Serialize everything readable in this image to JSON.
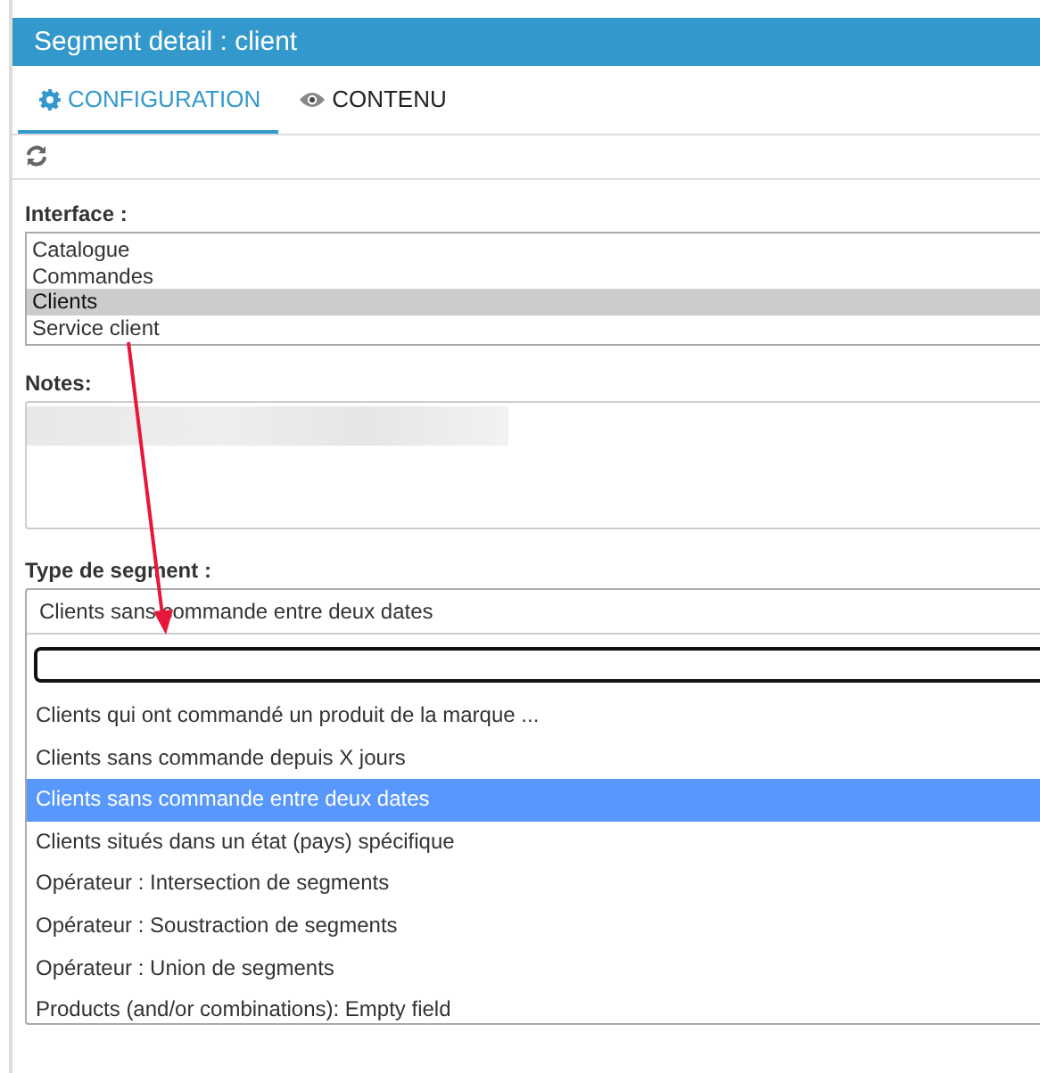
{
  "window": {
    "title": "Segment detail : client"
  },
  "tabs": [
    {
      "label": "CONFIGURATION",
      "kind": "gear",
      "selected": true
    },
    {
      "label": "CONTENU",
      "kind": "eye",
      "selected": false
    }
  ],
  "interface": {
    "label": "Interface :",
    "options": [
      {
        "label": "Catalogue",
        "selected": false
      },
      {
        "label": "Commandes",
        "selected": false
      },
      {
        "label": "Clients",
        "selected": true
      },
      {
        "label": "Service client",
        "selected": false
      }
    ]
  },
  "notes": {
    "label": "Notes:"
  },
  "segment_type": {
    "label": "Type de segment :",
    "value": "Clients sans commande entre deux dates",
    "options": [
      {
        "label": "Clients qui ont commandé un produit de la marque ...",
        "selected": false
      },
      {
        "label": "Clients sans commande depuis X jours",
        "selected": false
      },
      {
        "label": "Clients sans commande entre deux dates",
        "selected": true
      },
      {
        "label": "Clients situés dans un état (pays) spécifique",
        "selected": false
      },
      {
        "label": "Opérateur : Intersection de segments",
        "selected": false
      },
      {
        "label": "Opérateur : Soustraction de segments",
        "selected": false
      },
      {
        "label": "Opérateur : Union de segments",
        "selected": false
      },
      {
        "label": "Products (and/or combinations): Empty field",
        "selected": false
      }
    ]
  }
}
